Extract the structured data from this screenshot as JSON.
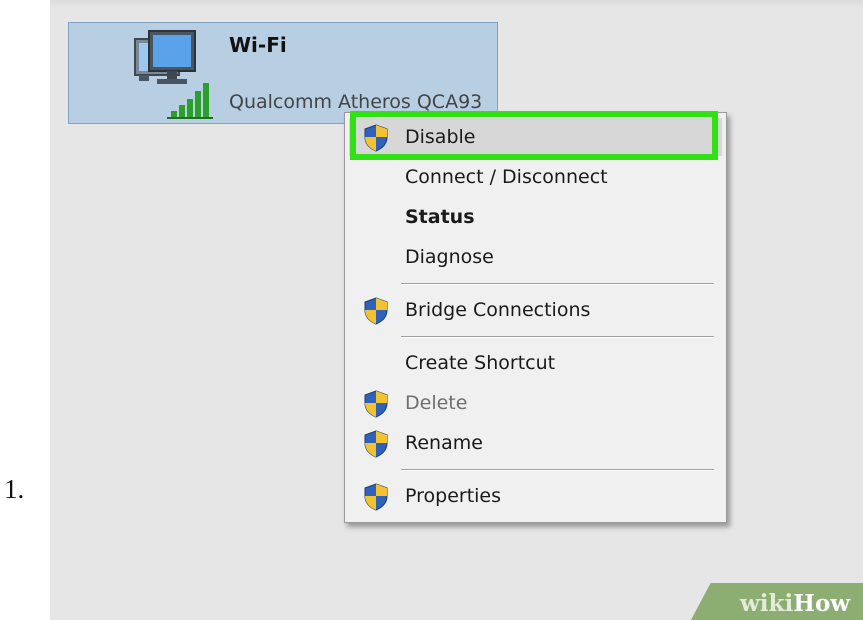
{
  "list_number": "1.",
  "adapter": {
    "name": "Wi-Fi",
    "device": "Qualcomm Atheros QCA93",
    "icons": [
      "network-computer-icon",
      "signal-bars-icon"
    ]
  },
  "context_menu": {
    "items": [
      {
        "label": "Disable",
        "shield": true,
        "state": "highlighted"
      },
      {
        "label": "Connect / Disconnect",
        "shield": false,
        "state": "normal"
      },
      {
        "label": "Status",
        "shield": false,
        "state": "bold"
      },
      {
        "label": "Diagnose",
        "shield": false,
        "state": "normal"
      },
      {
        "label": "Bridge Connections",
        "shield": true,
        "state": "normal"
      },
      {
        "label": "Create Shortcut",
        "shield": false,
        "state": "normal"
      },
      {
        "label": "Delete",
        "shield": true,
        "state": "disabled"
      },
      {
        "label": "Rename",
        "shield": true,
        "state": "normal"
      },
      {
        "label": "Properties",
        "shield": true,
        "state": "normal"
      }
    ]
  },
  "annotation": {
    "highlight_color": "#33e016",
    "target": "Disable"
  },
  "watermark": {
    "part1": "wiki",
    "part2": "How"
  },
  "colors": {
    "tile_bg": "#b8cfe3",
    "menu_bg": "#f0f0f0",
    "shield_blue": "#2f62b8",
    "shield_yellow": "#f2c230"
  }
}
